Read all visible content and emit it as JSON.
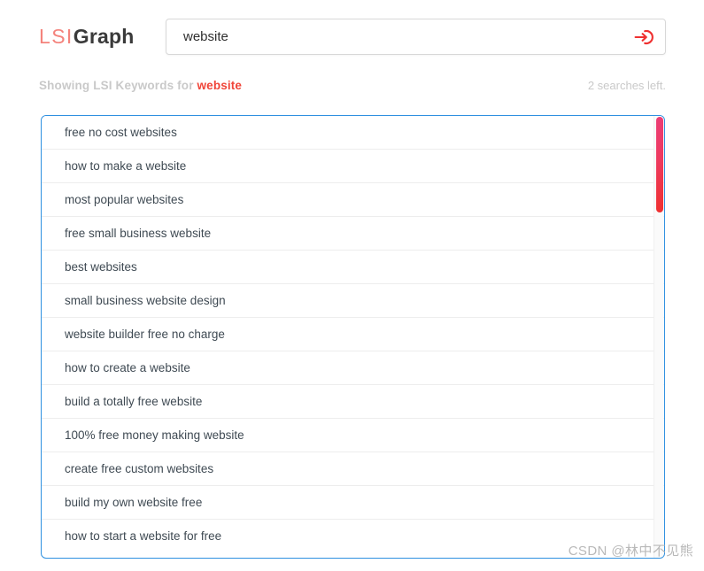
{
  "brand": {
    "logo_part1": "LSI",
    "logo_part2": "Graph",
    "color_primary": "#f4837c",
    "color_dark": "#3a3a3a"
  },
  "search": {
    "value": "website",
    "placeholder": "Enter a keyword",
    "submit_icon": "sign-in-arrow-icon",
    "submit_color": "#ef3030"
  },
  "status": {
    "prefix": "Showing LSI Keywords for ",
    "keyword": "website",
    "searches_left": "2 searches left.",
    "keyword_color": "#f04438",
    "muted_color": "#c9c9c9"
  },
  "results": {
    "border_color": "#2e90e0",
    "scrollbar": {
      "thumb_gradient_start": "#ec3c75",
      "thumb_gradient_end": "#ef3030"
    },
    "keywords": [
      "free no cost websites",
      "how to make a website",
      "most popular websites",
      "free small business website",
      "best websites",
      "small business website design",
      "website builder free no charge",
      "how to create a website",
      "build a totally free website",
      "100% free money making website",
      "create free custom websites",
      "build my own website free",
      "how to start a website for free"
    ]
  },
  "watermark": {
    "text": "CSDN @林中不见熊"
  }
}
